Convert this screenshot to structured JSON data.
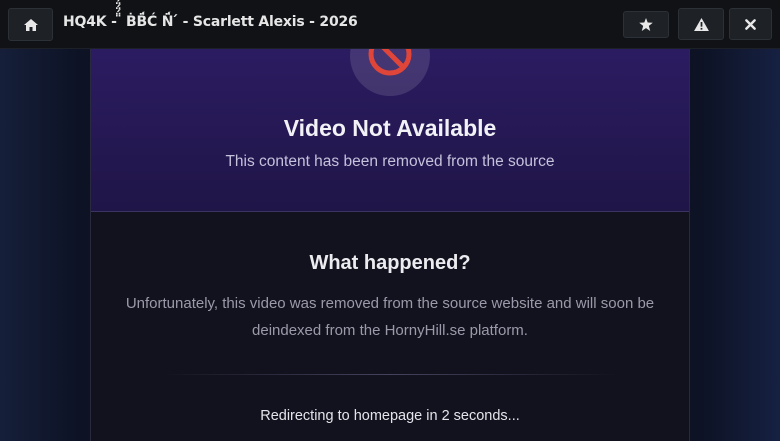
{
  "topbar": {
    "title": "HQ4K - ̈̈́̈́̈́ ḂB̈́Ć N̈́ ́ - Scarlett Alexis - 2026",
    "buttons": {
      "home": {
        "icon": "home-icon"
      },
      "favorite": {
        "icon": "star-icon"
      },
      "report": {
        "icon": "warning-icon"
      },
      "close": {
        "icon": "close-icon"
      }
    }
  },
  "hero": {
    "icon": "blocked-icon",
    "title": "Video Not Available",
    "subtitle": "This content has been removed from the source"
  },
  "details": {
    "heading": "What happened?",
    "body": "Unfortunately, this video was removed from the source website and will soon be deindexed from the HornyHill.se platform.",
    "redirect_text": "Redirecting to homepage in 2 seconds..."
  },
  "colors": {
    "accent_red": "#e0453a",
    "hero_purple": "#2f1d6a",
    "background": "#0b0f1c"
  }
}
